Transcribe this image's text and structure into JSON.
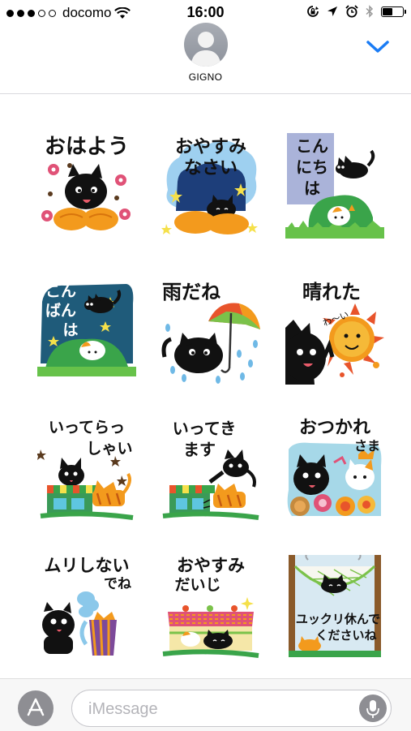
{
  "status_bar": {
    "carrier": "docomo",
    "time": "16:00",
    "signal_dots": [
      1,
      1,
      1,
      0,
      0
    ],
    "icons": [
      "wifi-icon",
      "rotation-lock-icon",
      "location-arrow-icon",
      "alarm-icon",
      "bluetooth-icon",
      "battery-icon"
    ],
    "battery_level": 0.55
  },
  "header": {
    "contact_name": "GIGNO",
    "avatar_icon": "person-silhouette-icon",
    "details_icon": "chevron-down-icon",
    "accent_color": "#1a7cf5"
  },
  "stickers": [
    {
      "id": "ohayou",
      "lines": [
        "おはよう"
      ]
    },
    {
      "id": "oyasuminasai",
      "lines": [
        "おやすみ",
        "なさい"
      ]
    },
    {
      "id": "konnichiha",
      "lines": [
        "こん",
        "にち",
        "は"
      ]
    },
    {
      "id": "konbanha",
      "lines": [
        "こん",
        "ばん",
        "は"
      ]
    },
    {
      "id": "ameda",
      "lines": [
        "雨だね"
      ]
    },
    {
      "id": "hareta",
      "lines": [
        "晴れた"
      ]
    },
    {
      "id": "itterasshai",
      "lines": [
        "いってらっ",
        "しゃい"
      ]
    },
    {
      "id": "ittekimasu",
      "lines": [
        "いってき",
        "ます"
      ]
    },
    {
      "id": "otsukaresama",
      "lines": [
        "おつかれ",
        "さま"
      ]
    },
    {
      "id": "murishinaidene",
      "lines": [
        "ムリしない",
        "でね"
      ]
    },
    {
      "id": "oyasumidaiji",
      "lines": [
        "おやすみ",
        "だいじ"
      ]
    },
    {
      "id": "yukkuriyasunde",
      "lines": [
        "ユックリ休んで",
        "くださいね"
      ]
    }
  ],
  "input_bar": {
    "placeholder": "iMessage",
    "value": "",
    "app_store_icon": "app-store-icon",
    "mic_icon": "microphone-icon"
  }
}
